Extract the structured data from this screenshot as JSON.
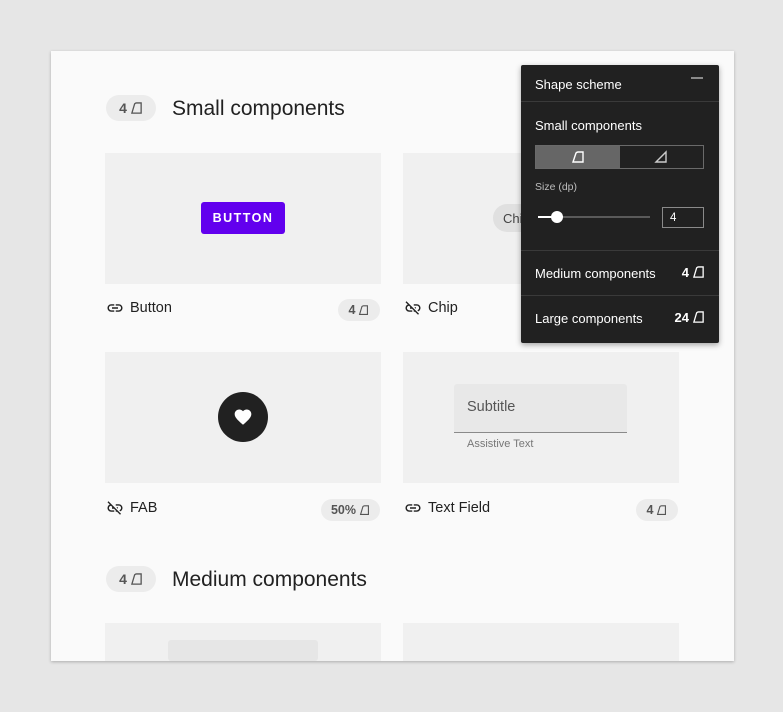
{
  "small_section": {
    "badge": "4",
    "title": "Small components"
  },
  "medium_section": {
    "badge": "4",
    "title": "Medium components"
  },
  "cards": [
    {
      "name": "Button",
      "link_state": "linked",
      "badge": "4",
      "demo": "BUTTON"
    },
    {
      "name": "Chip",
      "link_state": "unlinked",
      "demo": "Chi"
    },
    {
      "name": "FAB",
      "link_state": "unlinked",
      "badge": "50%"
    },
    {
      "name": "Text Field",
      "link_state": "linked",
      "badge": "4",
      "demo_subtitle": "Subtitle",
      "demo_helper": "Assistive Text"
    }
  ],
  "panel": {
    "title": "Shape scheme",
    "subsection": "Small components",
    "toggle_selected": "rounded",
    "size_label": "Size (dp)",
    "size_value": "4",
    "slider_fraction": 0.17,
    "medium": {
      "label": "Medium components",
      "value": "4"
    },
    "large": {
      "label": "Large components",
      "value": "24"
    }
  },
  "colors": {
    "primary": "#6200ee",
    "panel_bg": "#212121",
    "sheet_bg": "#fafafa"
  },
  "icons": [
    "link-icon",
    "link-off-icon",
    "rounded-corner-icon",
    "cut-corner-icon",
    "heart-icon"
  ]
}
